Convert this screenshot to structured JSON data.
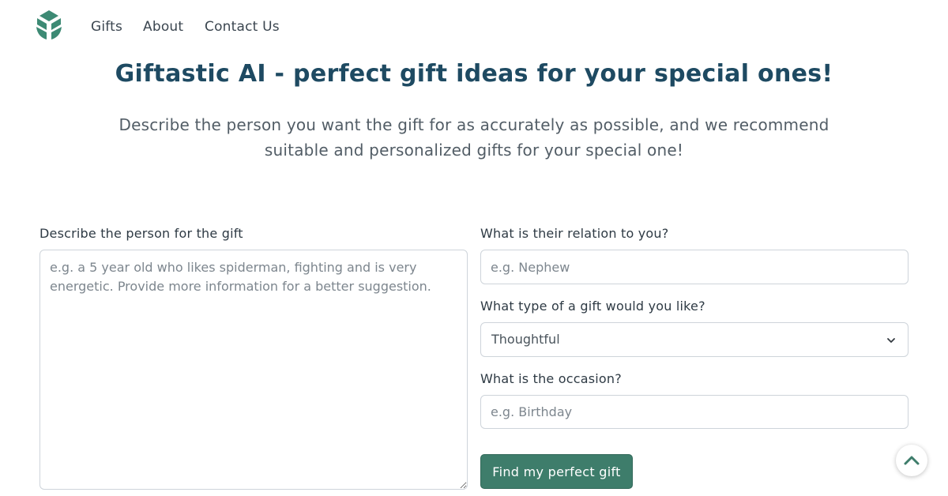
{
  "nav": {
    "logo_icon": "leaf-cube-logo",
    "links": [
      {
        "label": "Gifts"
      },
      {
        "label": "About"
      },
      {
        "label": "Contact Us"
      }
    ]
  },
  "hero": {
    "title": "Giftastic AI - perfect gift ideas for your special ones!",
    "subtitle": "Describe the person you want the gift for as accurately as possible, and we recommend suitable and personalized gifts for your special one!"
  },
  "form": {
    "person": {
      "label": "Describe the person for the gift",
      "value": "",
      "placeholder": "e.g. a 5 year old who likes spiderman, fighting and is very energetic. Provide more information for a better suggestion."
    },
    "relation": {
      "label": "What is their relation to you?",
      "value": "",
      "placeholder": "e.g. Nephew"
    },
    "gift_type": {
      "label": "What type of a gift would you like?",
      "selected": "Thoughtful",
      "icon": "chevron-down-icon"
    },
    "occasion": {
      "label": "What is the occasion?",
      "value": "",
      "placeholder": "e.g. Birthday"
    },
    "submit_label": "Find my perfect gift"
  },
  "scroll_top": {
    "icon": "chevron-up-icon"
  },
  "colors": {
    "accent": "#3e7d6b",
    "title": "#1e4a62",
    "logo": "#3d8a74",
    "border": "#ced4da"
  }
}
